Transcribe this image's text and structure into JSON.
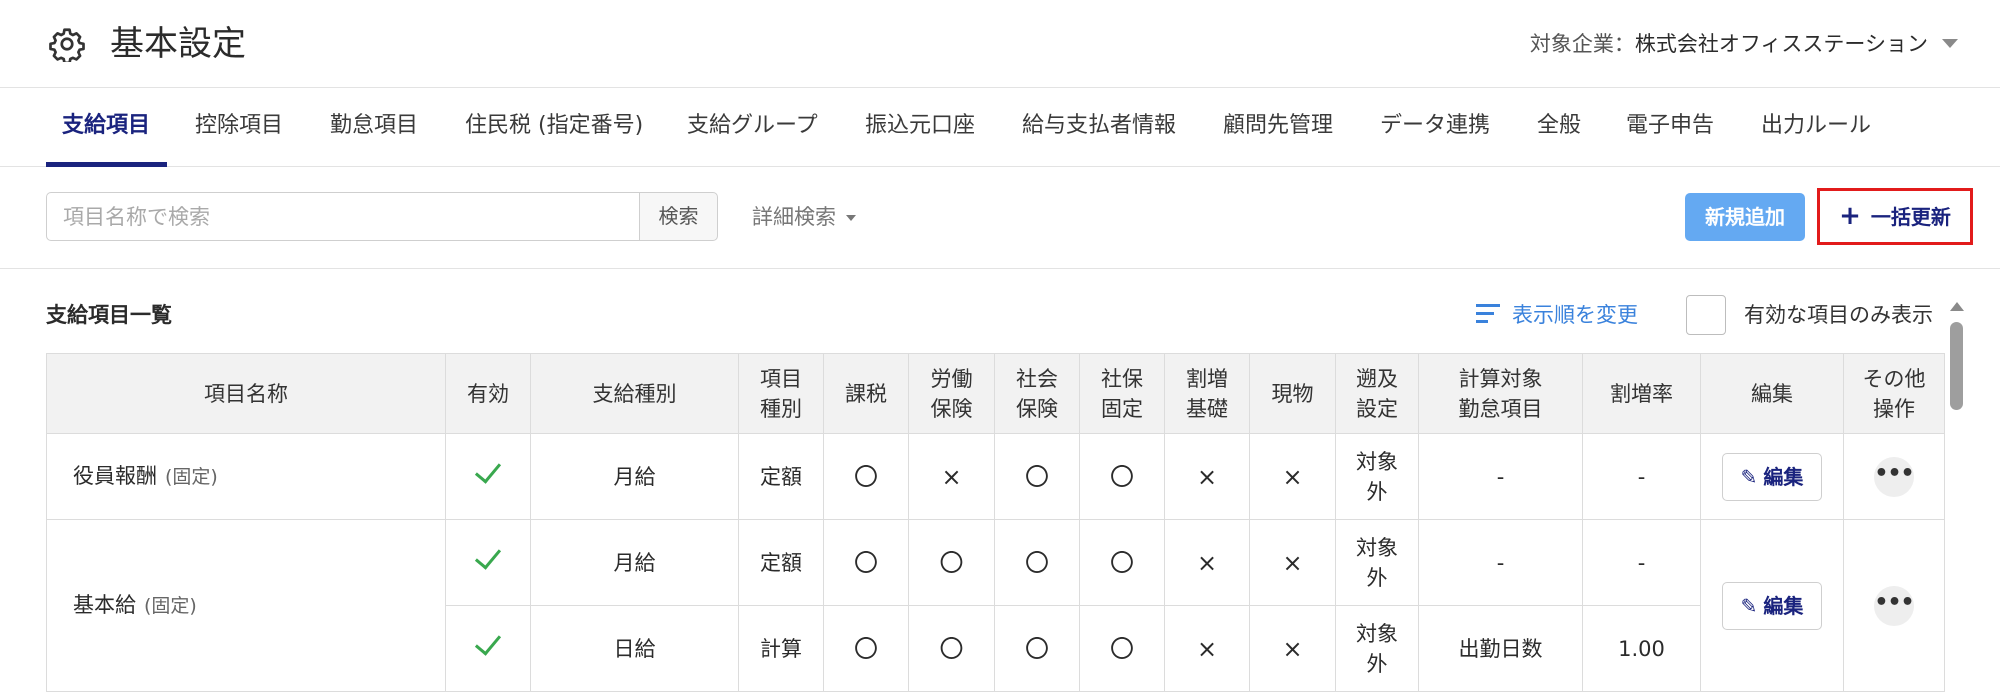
{
  "header": {
    "icon": "gear-icon",
    "title": "基本設定",
    "company_label": "対象企業：",
    "company_name": "株式会社オフィスステーション"
  },
  "tabs": [
    {
      "label": "支給項目",
      "active": true
    },
    {
      "label": "控除項目"
    },
    {
      "label": "勤怠項目"
    },
    {
      "label": "住民税 (指定番号)"
    },
    {
      "label": "支給グループ"
    },
    {
      "label": "振込元口座"
    },
    {
      "label": "給与支払者情報"
    },
    {
      "label": "顧問先管理"
    },
    {
      "label": "データ連携"
    },
    {
      "label": "全般"
    },
    {
      "label": "電子申告"
    },
    {
      "label": "出力ルール"
    }
  ],
  "toolbar": {
    "search_placeholder": "項目名称で検索",
    "search_button": "検索",
    "detail_search": "詳細検索",
    "new_button": "新規追加",
    "bulk_plus": "+",
    "bulk_button": "一括更新"
  },
  "list": {
    "title": "支給項目一覧",
    "sort_link": "表示順を変更",
    "only_valid_label": "有効な項目のみ表示"
  },
  "table": {
    "headers": {
      "name": "項目名称",
      "valid": "有効",
      "pay_type": "支給種別",
      "item_type_1": "項目",
      "item_type_2": "種別",
      "tax": "課税",
      "labor_1": "労働",
      "labor_2": "保険",
      "social_1": "社会",
      "social_2": "保険",
      "fixed_1": "社保",
      "fixed_2": "固定",
      "premium_base_1": "割増",
      "premium_base_2": "基礎",
      "in_kind": "現物",
      "retro_1": "遡及",
      "retro_2": "設定",
      "attendance_1": "計算対象",
      "attendance_2": "勤怠項目",
      "rate": "割増率",
      "edit": "編集",
      "other_1": "その他",
      "other_2": "操作"
    },
    "rows": [
      {
        "name": "役員報酬",
        "tag": "(固定)",
        "pay_type": "月給",
        "item_type": "定額",
        "tax": "〇",
        "labor": "×",
        "social": "〇",
        "fixed": "〇",
        "premium_base": "×",
        "in_kind": "×",
        "retro_1": "対象",
        "retro_2": "外",
        "attendance": "-",
        "rate": "-"
      },
      {
        "name": "基本給",
        "tag": "(固定)",
        "pay_type": "月給",
        "item_type": "定額",
        "tax": "〇",
        "labor": "〇",
        "social": "〇",
        "fixed": "〇",
        "premium_base": "×",
        "in_kind": "×",
        "retro_1": "対象",
        "retro_2": "外",
        "attendance": "-",
        "rate": "-"
      },
      {
        "pay_type": "日給",
        "item_type": "計算",
        "tax": "〇",
        "labor": "〇",
        "social": "〇",
        "fixed": "〇",
        "premium_base": "×",
        "in_kind": "×",
        "retro_1": "対象",
        "retro_2": "外",
        "attendance": "出勤日数",
        "rate": "1.00"
      }
    ],
    "edit_label": "編集",
    "more_label": "•••"
  },
  "colors": {
    "primary": "#1a237e",
    "accent_blue": "#64a9f2",
    "link_blue": "#3a82dc",
    "highlight_red": "#e21b1b",
    "check_green": "#39a84e"
  }
}
